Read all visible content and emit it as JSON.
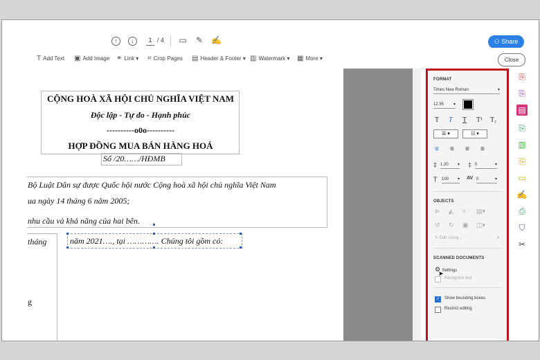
{
  "toolbar": {
    "page_current": "1",
    "page_total": "/ 4",
    "share_label": "Share"
  },
  "edit_toolbar": {
    "add_text": "Add Text",
    "add_image": "Add Image",
    "link": "Link",
    "crop_pages": "Crop Pages",
    "header_footer": "Header & Footer",
    "watermark": "Watermark",
    "more": "More",
    "close": "Close"
  },
  "document": {
    "line1": "CỘNG HOÀ XÃ HỘI CHỦ NGHĨA VIỆT NAM",
    "line2": "Độc lập - Tự do - Hạnh phúc",
    "line3": "----------o0o----------",
    "line4": "HỢP ĐỒNG MUA BÁN HÀNG HOÁ",
    "line5": "Số      /20……/HĐMB",
    "para1": "Bộ Luật Dân sự được Quốc hội nước Cộng hoà xã hội chủ nghĩa Việt Nam",
    "para2": "ua ngày 14 tháng 6 năm 2005;",
    "para3": "nhu cầu và khả năng của hai bên.",
    "para4a": "tháng",
    "para4b": "năm 2021…., tại …………. Chúng tôi gồm có:",
    "para5": "g"
  },
  "format_panel": {
    "format_heading": "FORMAT",
    "font_name": "Times New Roman",
    "font_size": "12.95",
    "color": "#000000",
    "line_spacing": "1.20",
    "para_spacing": "0",
    "scale": "100",
    "char_spacing": "0",
    "char_spacing_label": "AV",
    "objects_heading": "OBJECTS",
    "edit_using": "Edit Using...",
    "scanned_heading": "SCANNED DOCUMENTS",
    "settings": "Settings",
    "recognize_text": "Recognize text",
    "show_bounding_boxes": "Show bounding boxes",
    "show_bounding_boxes_checked": true,
    "restrict_editing": "Restrict editing",
    "restrict_editing_checked": false
  },
  "tool_strip": {
    "icons": [
      "export-pdf-icon",
      "comment-pdf-icon",
      "edit-pdf-icon",
      "create-pdf-icon",
      "organize-pages-icon",
      "export-icon",
      "comment-icon",
      "fill-sign-icon",
      "print-production-icon",
      "protect-icon",
      "more-tools-icon"
    ],
    "active_color": "#d5307a"
  },
  "colors": {
    "accent": "#2b80e6",
    "panel_highlight": "#c0141f"
  }
}
